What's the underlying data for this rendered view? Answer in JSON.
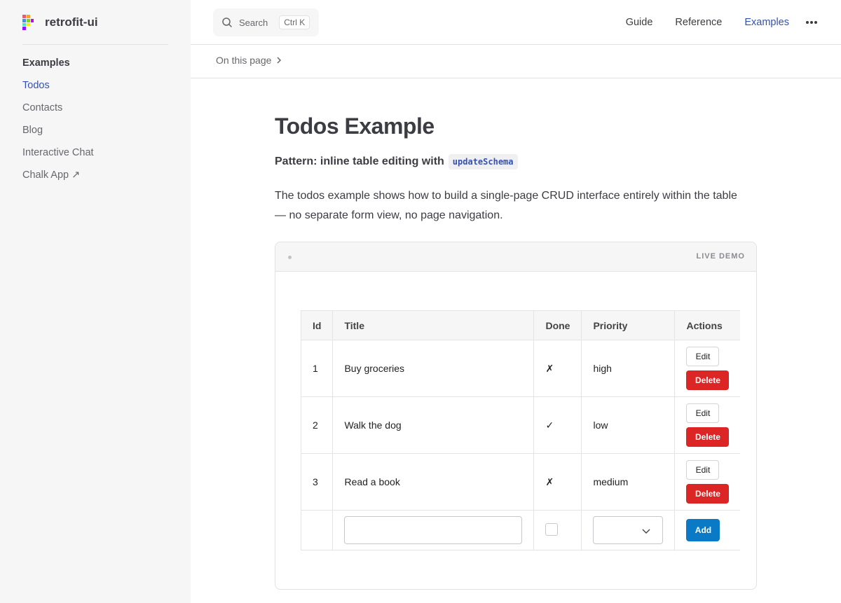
{
  "brand": {
    "name": "retrofit-ui"
  },
  "sidebar": {
    "heading": "Examples",
    "items": [
      {
        "label": "Todos",
        "active": true
      },
      {
        "label": "Contacts"
      },
      {
        "label": "Blog"
      },
      {
        "label": "Interactive Chat"
      },
      {
        "label": "Chalk App ↗"
      }
    ]
  },
  "search": {
    "label": "Search",
    "shortcut": "Ctrl K"
  },
  "topnav": {
    "guide": "Guide",
    "reference": "Reference",
    "examples": "Examples"
  },
  "localnav": {
    "label": "On this page"
  },
  "page": {
    "title": "Todos Example",
    "pattern_prefix": "Pattern: inline table editing with",
    "pattern_code": "updateSchema",
    "description": "The todos example shows how to build a single-page CRUD interface entirely within the table — no separate form view, no page navigation."
  },
  "demo": {
    "label": "LIVE DEMO",
    "table": {
      "headers": {
        "id": "Id",
        "title": "Title",
        "done": "Done",
        "priority": "Priority",
        "actions": "Actions"
      },
      "rows": [
        {
          "id": "1",
          "title": "Buy groceries",
          "done": "✗",
          "priority": "high"
        },
        {
          "id": "2",
          "title": "Walk the dog",
          "done": "✓",
          "priority": "low"
        },
        {
          "id": "3",
          "title": "Read a book",
          "done": "✗",
          "priority": "medium"
        }
      ],
      "edit_label": "Edit",
      "delete_label": "Delete",
      "add_label": "Add"
    }
  },
  "colors": {
    "accent": "#3451b2",
    "delete": "#dc2626",
    "add": "#0b7ac6",
    "sidebar_bg": "#f6f6f7"
  }
}
